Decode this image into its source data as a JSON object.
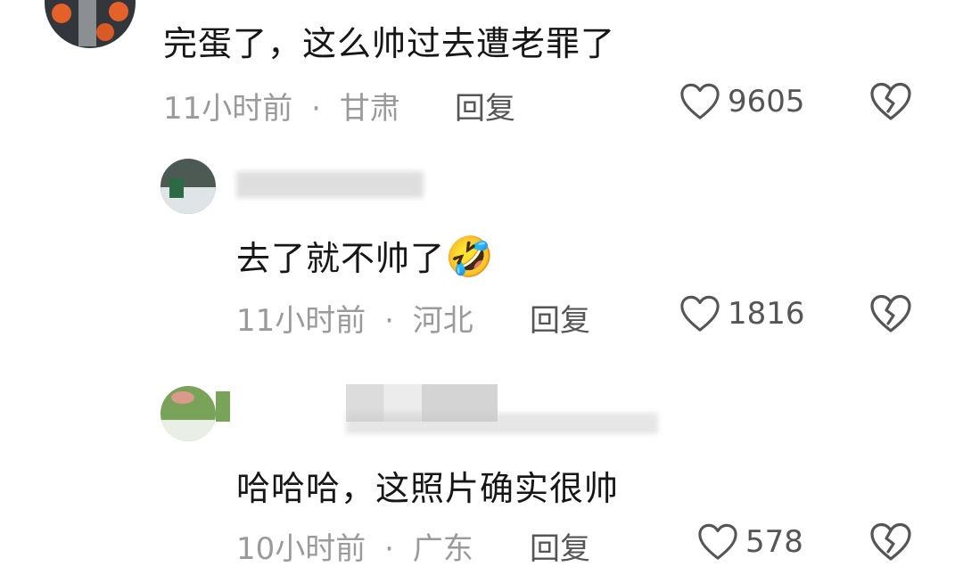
{
  "comments": [
    {
      "text": "完蛋了，这么帅过去遭老罪了",
      "time": "11小时前",
      "location": "甘肃",
      "reply_label": "回复",
      "likes": "9605"
    },
    {
      "text": "去了就不帅了",
      "emoji": "🤣",
      "time": "11小时前",
      "location": "河北",
      "reply_label": "回复",
      "likes": "1816"
    },
    {
      "text": "哈哈哈，这照片确实很帅",
      "time": "10小时前",
      "location": "广东",
      "reply_label": "回复",
      "likes": "578"
    }
  ],
  "separator": "·",
  "icons": {
    "like": "heart-outline-icon",
    "dislike": "broken-heart-icon"
  },
  "colors": {
    "meta": "#9a9a9a",
    "text": "#161616",
    "icon": "#555555"
  }
}
